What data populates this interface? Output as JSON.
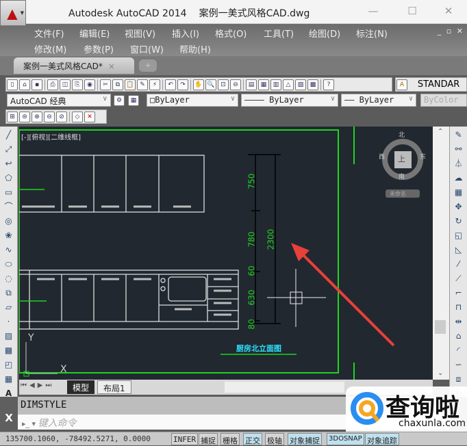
{
  "app": {
    "name": "Autodesk AutoCAD 2014",
    "file": "案例一美式风格CAD.dwg",
    "logo_letter": "A"
  },
  "menu": [
    "文件(F)",
    "编辑(E)",
    "视图(V)",
    "插入(I)",
    "格式(O)",
    "工具(T)",
    "绘图(D)",
    "标注(N)",
    "修改(M)",
    "参数(P)",
    "窗口(W)",
    "帮助(H)"
  ],
  "doc_tab": {
    "label": "案例一美式风格CAD*",
    "close": "×"
  },
  "toolbar": {
    "text_style": "STANDAR",
    "workspace": "AutoCAD 经典",
    "layer_color": "□ByLayer",
    "linetype": "———— ByLayer",
    "lineweight": "—— ByLayer",
    "plot_style": "ByColor"
  },
  "viewport": {
    "label": "[-][俯视][二维线框]",
    "compass": {
      "n": "北",
      "s": "南",
      "e": "东",
      "w": "西",
      "top": "上"
    },
    "ucs_name": "未命名",
    "ucs_x": "X",
    "ucs_y": "Y"
  },
  "drawing": {
    "dims": [
      "750",
      "780",
      "60",
      "630",
      "80"
    ],
    "total": "2300",
    "title": "厨房北立面图"
  },
  "layout_tabs": [
    "模型",
    "布局1"
  ],
  "command": {
    "history": "DIMSTYLE",
    "placeholder": "键入命令",
    "close": "X"
  },
  "status": {
    "coords": "135700.1060, -78492.5271, 0.0000",
    "toggles": [
      {
        "label": "INFER",
        "on": false
      },
      {
        "label": "捕捉",
        "on": false
      },
      {
        "label": "栅格",
        "on": false
      },
      {
        "label": "正交",
        "on": true
      },
      {
        "label": "极轴",
        "on": false
      },
      {
        "label": "对象捕捉",
        "on": true
      },
      {
        "label": "3DOSNAP",
        "on": true
      },
      {
        "label": "对象追踪",
        "on": true
      }
    ]
  },
  "watermark": {
    "name": "查询啦",
    "url": "chaxunla.com"
  },
  "colors": {
    "canvas": "#212830",
    "green": "#1fd41f",
    "cyan": "#2fe0ff",
    "arrow": "#e8403a"
  }
}
